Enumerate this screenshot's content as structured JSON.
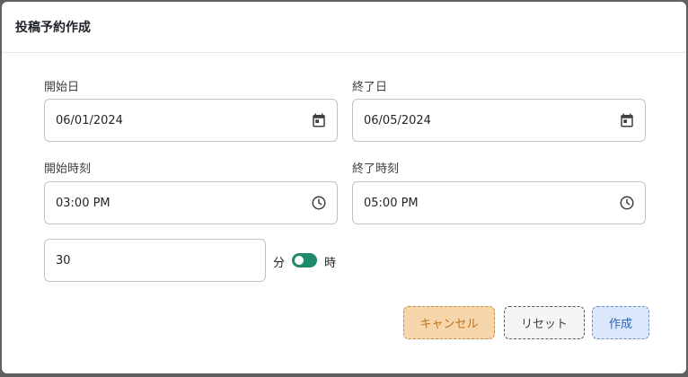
{
  "dialog": {
    "title": "投稿予約作成"
  },
  "form": {
    "start_date": {
      "label": "開始日",
      "value": "06/01/2024",
      "icon": "calendar-icon"
    },
    "end_date": {
      "label": "終了日",
      "value": "06/05/2024",
      "icon": "calendar-icon"
    },
    "start_time": {
      "label": "開始時刻",
      "value": "03:00 PM",
      "icon": "clock-icon"
    },
    "end_time": {
      "label": "終了時刻",
      "value": "05:00 PM",
      "icon": "clock-icon"
    },
    "interval": {
      "value": "30",
      "unit_left": "分",
      "unit_right": "時",
      "toggle_on": true
    }
  },
  "buttons": {
    "cancel": "キャンセル",
    "reset": "リセット",
    "create": "作成"
  },
  "colors": {
    "toggle": "#1f8a6a",
    "cancel_bg": "#f8d6ac",
    "create_bg": "#dbe8fb"
  }
}
